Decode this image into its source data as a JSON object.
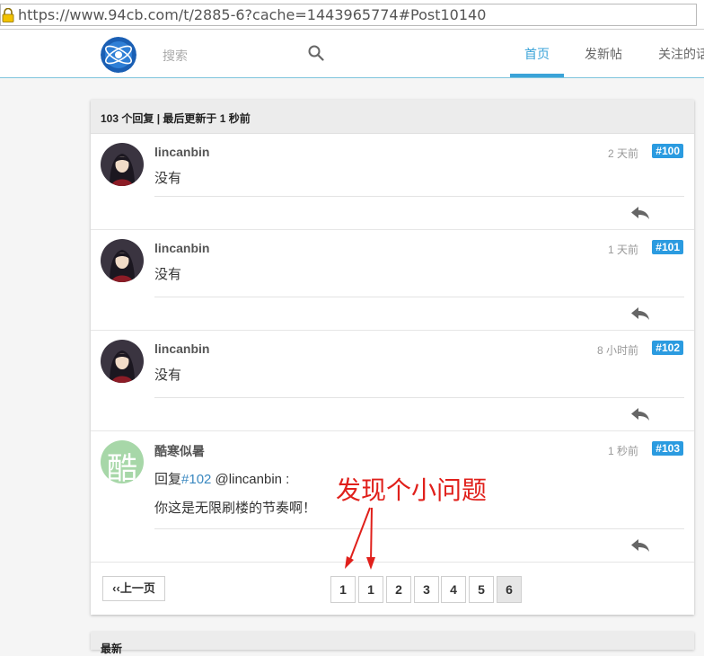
{
  "browser": {
    "url": "https://www.94cb.com/t/2885-6?cache=1443965774#Post10140"
  },
  "nav": {
    "search_placeholder": "搜索",
    "tabs": [
      {
        "label": "首页",
        "active": true
      },
      {
        "label": "发新帖",
        "active": false
      },
      {
        "label": "关注的话",
        "active": false
      }
    ]
  },
  "thread": {
    "summary": "103 个回复 | 最后更新于 1 秒前",
    "posts": [
      {
        "author": "lincanbin",
        "time": "2 天前",
        "floor": "#100",
        "content": "没有"
      },
      {
        "author": "lincanbin",
        "time": "1 天前",
        "floor": "#101",
        "content": "没有"
      },
      {
        "author": "lincanbin",
        "time": "8 小时前",
        "floor": "#102",
        "content": "没有"
      },
      {
        "author": "酷寒似暑",
        "time": "1 秒前",
        "floor": "#103",
        "avatar_char": "酷",
        "reply_prefix": "回复",
        "reply_ref": "#102",
        "reply_to": " @lincanbin :",
        "content": "你这是无限刷楼的节奏啊！"
      }
    ]
  },
  "pagination": {
    "prev_label": "‹‹上一页",
    "pages": [
      "1",
      "1",
      "2",
      "3",
      "4",
      "5",
      "6"
    ],
    "current": "6"
  },
  "annotation": "发现个小问题",
  "next_section_label": "最新",
  "colors": {
    "accent": "#3aa3d8",
    "floor_badge": "#2b9be0",
    "annotation": "#e0201b"
  }
}
